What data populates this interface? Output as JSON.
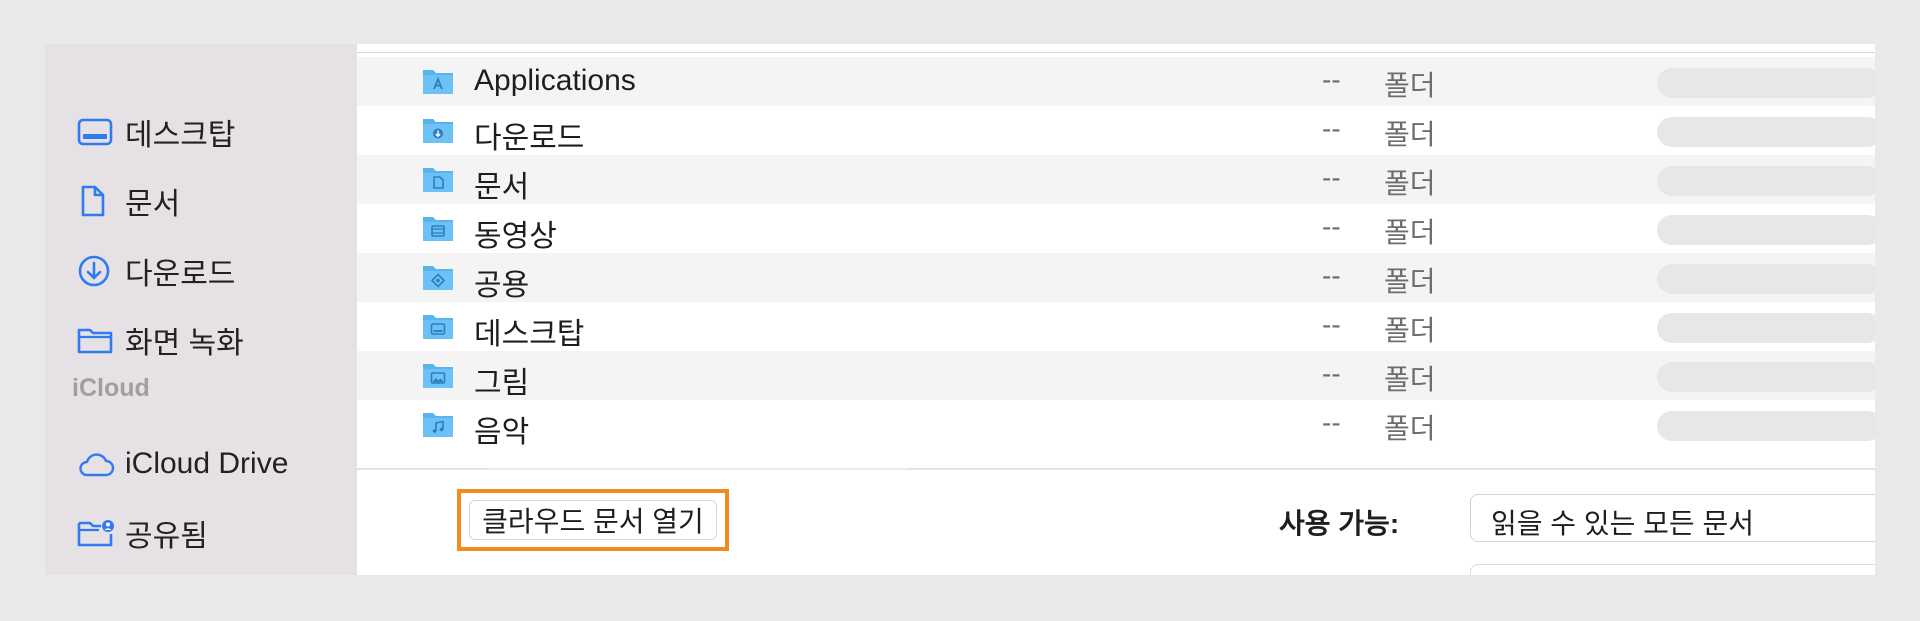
{
  "sidebar": {
    "items": [
      {
        "label": "데스크탑",
        "icon": "desktop-icon"
      },
      {
        "label": "문서",
        "icon": "document-icon"
      },
      {
        "label": "다운로드",
        "icon": "download-icon"
      },
      {
        "label": "화면 녹화",
        "icon": "folder-icon"
      }
    ],
    "section_title": "iCloud",
    "icloud_items": [
      {
        "label": "iCloud Drive",
        "icon": "cloud-icon"
      },
      {
        "label": "공유됨",
        "icon": "shared-folder-icon"
      }
    ]
  },
  "files": [
    {
      "name": "Applications",
      "size": "--",
      "kind": "폴더",
      "icon": "applications-folder-icon"
    },
    {
      "name": "다운로드",
      "size": "--",
      "kind": "폴더",
      "icon": "downloads-folder-icon"
    },
    {
      "name": "문서",
      "size": "--",
      "kind": "폴더",
      "icon": "documents-folder-icon"
    },
    {
      "name": "동영상",
      "size": "--",
      "kind": "폴더",
      "icon": "movies-folder-icon"
    },
    {
      "name": "공용",
      "size": "--",
      "kind": "폴더",
      "icon": "public-folder-icon"
    },
    {
      "name": "데스크탑",
      "size": "--",
      "kind": "폴더",
      "icon": "desktop-folder-icon"
    },
    {
      "name": "그림",
      "size": "--",
      "kind": "폴더",
      "icon": "pictures-folder-icon"
    },
    {
      "name": "음악",
      "size": "--",
      "kind": "폴더",
      "icon": "music-folder-icon"
    }
  ],
  "footer": {
    "cloud_button_label": "클라우드 문서 열기",
    "available_label": "사용 가능:",
    "filter_value": "읽을 수 있는 모든 문서"
  },
  "colors": {
    "accent": "#2f7bf2",
    "highlight": "#f28c1e",
    "sidebar_bg": "#e6e1e4"
  }
}
